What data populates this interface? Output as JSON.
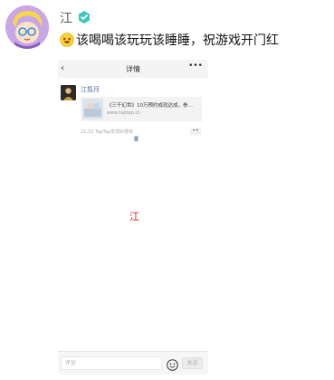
{
  "post": {
    "username": "江",
    "text": "该喝喝该玩玩该睡睡，祝游戏开门红"
  },
  "phone": {
    "title": "详情",
    "friend_name": "江揽月",
    "share_title": "《三千幻世》10万预约成就达成，参…",
    "share_domain": "www.taptap.cn",
    "meta": "21:32 TapTap发现好游戏",
    "comment_placeholder": "评论",
    "send_label": "发送"
  },
  "overlay": {
    "char": "江"
  },
  "colors": {
    "link": "#4a6a96",
    "overlay": "#e02020",
    "badge": "#3ec6c0"
  }
}
